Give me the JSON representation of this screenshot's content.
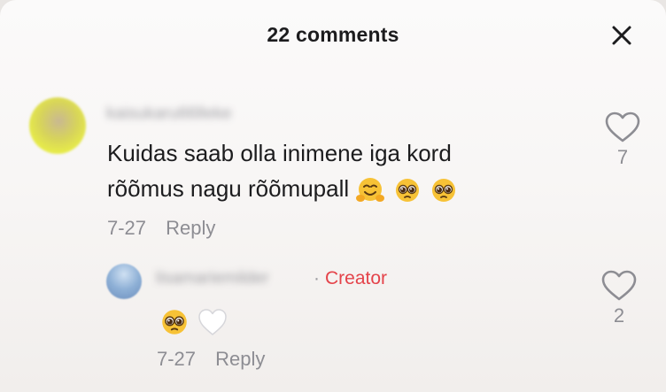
{
  "header": {
    "title": "22 comments",
    "close_icon": "close-icon"
  },
  "comments": [
    {
      "username": "kaisukaru66lleke",
      "text": "Kuidas saab olla inimene iga kord rõõmus nagu rõõmupall",
      "emojis": [
        "hugging-face",
        "pleading-face",
        "pleading-face"
      ],
      "date": "7-27",
      "reply_label": "Reply",
      "likes": "7"
    },
    {
      "username": "lisamariemilder",
      "creator_separator": "·",
      "creator_label": "Creator",
      "emojis": [
        "pleading-face",
        "white-heart"
      ],
      "date": "7-27",
      "reply_label": "Reply",
      "likes": "2"
    }
  ],
  "colors": {
    "creator": "#e4434a",
    "meta_text": "#8d8d93",
    "primary_text": "#1c1c1e"
  }
}
